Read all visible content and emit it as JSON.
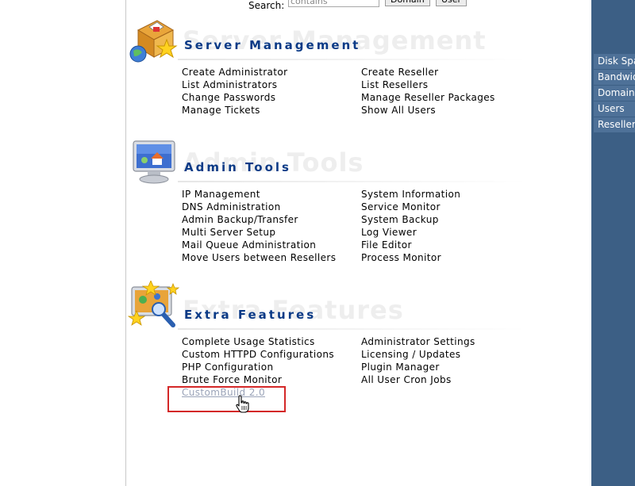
{
  "search": {
    "label": "Search:",
    "value": "contains",
    "domain_button": "Domain",
    "user_button": "User"
  },
  "right_panel": {
    "items": [
      "Disk Space",
      "Bandwidth",
      "Domains",
      "Users",
      "Resellers"
    ]
  },
  "sections": {
    "server": {
      "title": "Server Management",
      "ghost": "Server Management",
      "left": [
        "Create Administrator",
        "List Administrators",
        "Change Passwords",
        "Manage Tickets"
      ],
      "right": [
        "Create Reseller",
        "List Resellers",
        "Manage Reseller Packages",
        "Show All Users"
      ]
    },
    "admin": {
      "title": "Admin Tools",
      "ghost": "Admin Tools",
      "left": [
        "IP Management",
        "DNS Administration",
        "Admin Backup/Transfer",
        "Multi Server Setup",
        "Mail Queue Administration",
        "Move Users between Resellers"
      ],
      "right": [
        "System Information",
        "Service Monitor",
        "System Backup",
        "Log Viewer",
        "File Editor",
        "Process Monitor"
      ]
    },
    "extra": {
      "title": "Extra Features",
      "ghost": "Extra Features",
      "left": [
        "Complete Usage Statistics",
        "Custom HTTPD Configurations",
        "PHP Configuration",
        "Brute Force Monitor",
        "CustomBuild 2.0"
      ],
      "right": [
        "Administrator Settings",
        "Licensing / Updates",
        "Plugin Manager",
        "All User Cron Jobs"
      ]
    }
  },
  "colors": {
    "title": "#0b3a86",
    "panel": "#3c5f85",
    "highlight": "#d42828"
  }
}
